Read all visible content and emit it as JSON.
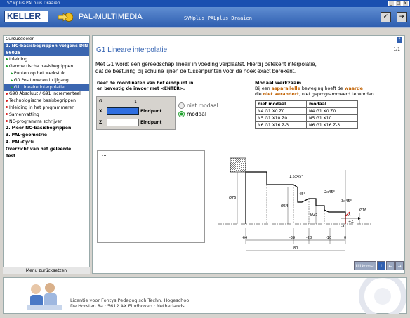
{
  "window": {
    "title": "SYMplus PALplus Draaien",
    "min": "_",
    "max": "□",
    "close": "×"
  },
  "header": {
    "logo": "KELLER",
    "app_name": "PAL-MULTIMEDIA",
    "title": "SYMplus PALplus Draaien"
  },
  "sidebar": {
    "items": [
      {
        "label": "Cursusdoelen",
        "style": "plain"
      },
      {
        "label": "1. NC-basisbegrippen volgens DIN",
        "style": "head"
      },
      {
        "label": "66025",
        "style": "head"
      },
      {
        "label": "Inleiding",
        "style": "green"
      },
      {
        "label": "Geometrische basisbegrippen",
        "style": "green"
      },
      {
        "label": "Punten op het werkstuk",
        "style": "sub"
      },
      {
        "label": "G0 Positioneren in ijlgang",
        "style": "sub"
      },
      {
        "label": "G1 Lineaire interpolatie",
        "style": "sel"
      },
      {
        "label": "G90 Absoluut / G91 Incrementeel",
        "style": "red"
      },
      {
        "label": "Technologische basisbegrippen",
        "style": "red"
      },
      {
        "label": "Inleiding in het programmeren",
        "style": "red"
      },
      {
        "label": "Samenvatting",
        "style": "red"
      },
      {
        "label": "NC-programma schrijven",
        "style": "red"
      },
      {
        "label": "2. Meer NC-basisbegrippen",
        "style": "bold"
      },
      {
        "label": "3. PAL-geometrie",
        "style": "bold"
      },
      {
        "label": "4. PAL-Cycli",
        "style": "bold"
      },
      {
        "label": "Overzicht van het geleerde",
        "style": "bold"
      },
      {
        "label": "Test",
        "style": "bold"
      }
    ],
    "back": "Menu zurücksetzen"
  },
  "content": {
    "title": "G1 Lineare interpolatie",
    "pager": "1/1",
    "help": "?",
    "para1": "Met G1 wordt een gereedschap lineair in voeding verplaatst. Hierbij betekent interpolatie,",
    "para2": "dat de besturing bij schuine lijnen de tussenpunten voor de hoek exact berekent.",
    "form": {
      "label1": "Geef de coördinaten van het eindpunt in",
      "label2": "en bevestig de invoer met <ENTER>.",
      "g_label": "G",
      "g_value": "1",
      "x_label": "X",
      "x_value": "",
      "z_label": "Z",
      "z_value": "",
      "endpoint": "Eindpunt"
    },
    "radios": {
      "a": "niet modaal",
      "b": "modaal"
    },
    "modal": {
      "title": "Modaal werkzaam",
      "d1a": "Bij een ",
      "d1b": "asparallelle",
      "d1c": " beweging hoeft de ",
      "d1d": "waarde",
      "d2a": "die ",
      "d2b": "niet verandert",
      "d2c": ", niet geprogrammeerd te worden.",
      "headers": [
        "niet modaal",
        "modaal"
      ],
      "rows": [
        [
          "N4 G1 X0 Z0",
          "N4 G1 X0 Z0"
        ],
        [
          "N5 G1 X10 Z0",
          "N5 G1 X10"
        ],
        [
          "N6 G1 X16 Z-3",
          "N6 G1 X16 Z-3"
        ]
      ]
    },
    "box_text": "...",
    "drawing": {
      "d76": "Ø76",
      "d54": "Ø54",
      "d25": "Ø25",
      "d16": "Ø16",
      "c1": "1.5x45°",
      "c2": "2x45°",
      "c3": "3x45°",
      "a45": "45°",
      "xl": "X",
      "zl": "+Z",
      "neg": "-X",
      "t64": "-64",
      "t39": "-39",
      "t28": "-28",
      "t10": "-10",
      "t0": "0",
      "total": "80"
    },
    "toolbar": {
      "print": "Uitkomst",
      "info": "i",
      "prev": "←",
      "next": "→"
    }
  },
  "footer": {
    "line1": "Licentie voor Fontys Pedagogisch Techn. Hogeschool",
    "line2": "De Horsten 8a · 5612 AX Eindhoven · Netherlands"
  },
  "colors": {
    "accent": "#2f5fb0",
    "green": "#1fa12c",
    "red": "#d62020",
    "orange": "#c06000"
  }
}
